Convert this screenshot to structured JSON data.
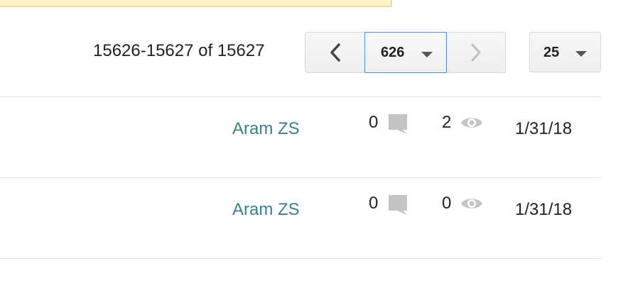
{
  "pagination": {
    "range_text": "15626-15627 of 15627",
    "current_page": "626",
    "page_size": "25"
  },
  "rows": [
    {
      "author": "Aram ZS",
      "comments": "0",
      "views": "2",
      "date": "1/31/18"
    },
    {
      "author": "Aram ZS",
      "comments": "0",
      "views": "0",
      "date": "1/31/18"
    }
  ],
  "icons": {
    "prev": "chevron-left-icon",
    "next": "chevron-right-icon",
    "dropdown": "caret-down-icon",
    "comment": "comment-icon",
    "views": "eye-icon"
  },
  "colors": {
    "author_link": "#3d7f89",
    "focus_border": "#4d8fd6",
    "icon_gray": "#c4c4c4",
    "notice_bg": "#fcf4c4"
  }
}
